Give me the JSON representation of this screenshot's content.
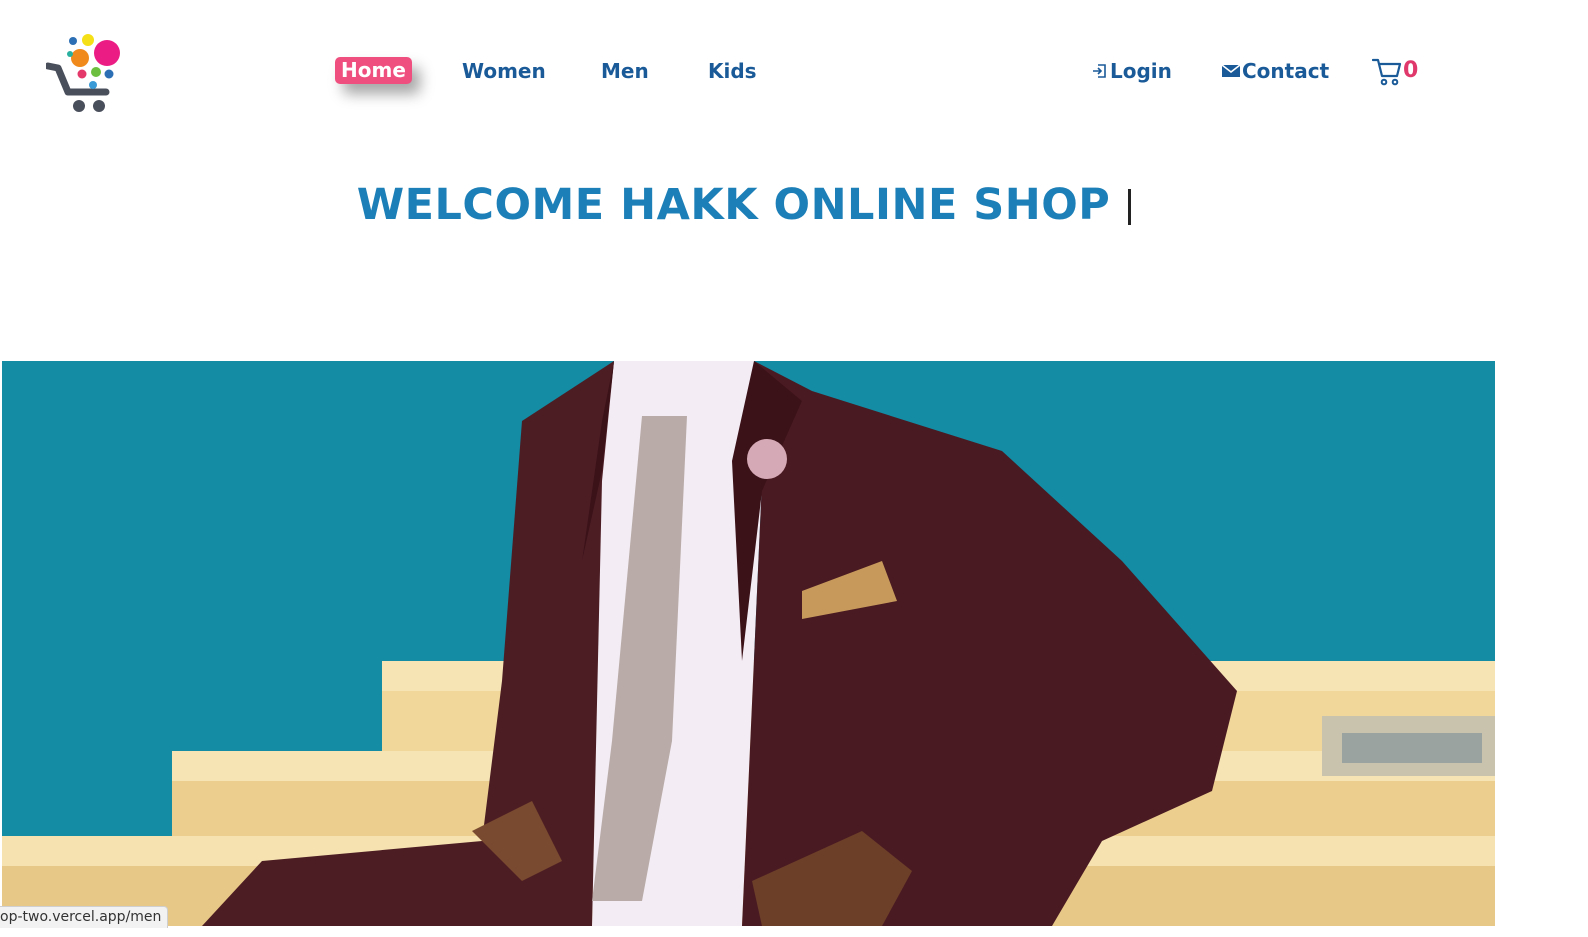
{
  "header": {
    "logo_icon": "shopping-cart-dots-logo",
    "nav": [
      {
        "label": "Home",
        "active": true
      },
      {
        "label": "Women"
      },
      {
        "label": "Men"
      },
      {
        "label": "Kids"
      }
    ],
    "login_label": "Login",
    "contact_label": "Contact",
    "cart_count": "0"
  },
  "hero": {
    "title": "WELCOME HAKK ONLINE SHOP"
  },
  "status_bar": {
    "url": "op-two.vercel.app/men"
  },
  "colors": {
    "nav_text": "#1a5a98",
    "active_pill": "#ef4f7f",
    "title": "#1d7fb7",
    "cart_count": "#e0386b",
    "hero_background": "#1590a8"
  }
}
